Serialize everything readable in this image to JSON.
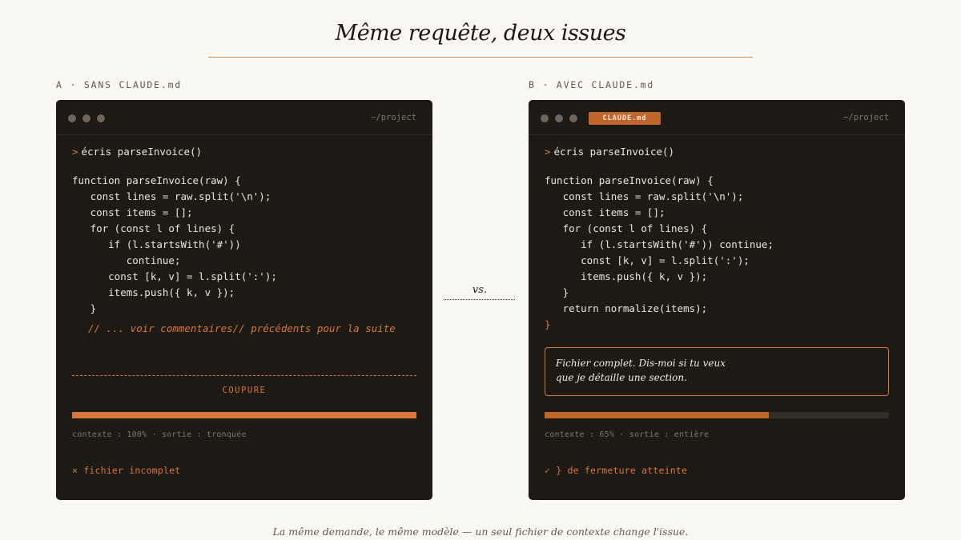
{
  "title": "Même requête, deux issues",
  "vs": "vs.",
  "caption": "La même demande, le même modèle — un seul fichier de contexte change l'issue.",
  "panels": {
    "a": {
      "label": "A · SANS CLAUDE.md",
      "path": "~/project",
      "prompt_symbol": ">",
      "prompt": "écris parseInvoice()",
      "code_lines": [
        "function parseInvoice(raw) {",
        "   const lines = raw.split('\\n');",
        "   const items = [];",
        "   for (const l of lines) {",
        "      if (l.startsWith('#'))",
        "         continue;",
        "      const [k, v] = l.split(':');",
        "      items.push({ k, v });",
        "   }"
      ],
      "comment_lines": [
        "// ... voir commentaires",
        "// précédents pour la suite"
      ],
      "cut_label": "COUPURE",
      "context_fill": 1.0,
      "context_text": "contexte : 100% · sortie : tronquée",
      "status": "× fichier incomplet",
      "accent": "#d9773a"
    },
    "b": {
      "label": "B · AVEC CLAUDE.md",
      "tab": "CLAUDE.md",
      "path": "~/project",
      "prompt_symbol": ">",
      "prompt": "écris parseInvoice()",
      "code_lines": [
        "function parseInvoice(raw) {",
        "   const lines = raw.split('\\n');",
        "   const items = [];",
        "   for (const l of lines) {",
        "      if (l.startsWith('#')) continue;",
        "      const [k, v] = l.split(':');",
        "      items.push({ k, v });",
        "   }",
        "   return normalize(items);"
      ],
      "closing_brace": "}",
      "note_lines": [
        "Fichier complet. Dis-moi si tu veux",
        "que je détaille une section."
      ],
      "context_fill": 0.65,
      "context_text": "contexte : 65% · sortie : entière",
      "status": "✓ } de fermeture atteinte",
      "accent": "#c2672c"
    }
  }
}
